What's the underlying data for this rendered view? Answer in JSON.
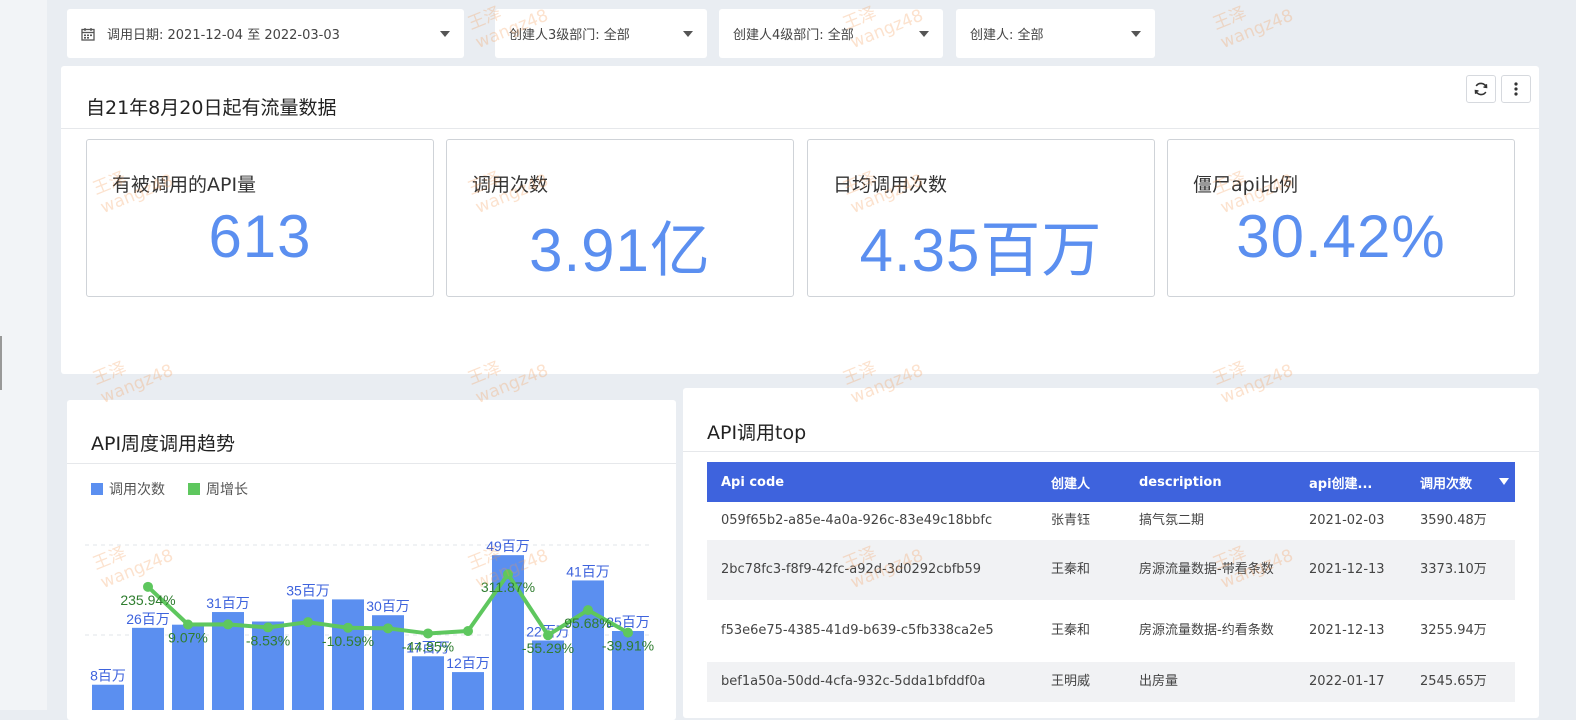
{
  "filters": {
    "date": "调用日期: 2021-12-04 至 2022-03-03",
    "dept3": "创建人3级部门: 全部",
    "dept4": "创建人4级部门: 全部",
    "creator": "创建人: 全部"
  },
  "overview": {
    "title": "自21年8月20日起有流量数据",
    "kpis": [
      {
        "label": "有被调用的API量",
        "value": "613"
      },
      {
        "label": "调用次数",
        "value": "3.91亿"
      },
      {
        "label": "日均调用次数",
        "value": "4.35百万"
      },
      {
        "label": "僵尸api比例",
        "value": "30.42%"
      }
    ]
  },
  "weekly": {
    "title": "API周度调用趋势",
    "legend": [
      "调用次数",
      "周增长"
    ]
  },
  "top": {
    "title": "API调用top",
    "headers": [
      "Api code",
      "创建人",
      "description",
      "api创建...",
      "调用次数"
    ],
    "rows": [
      [
        "059f65b2-a85e-4a0a-926c-83e49c18bbfc",
        "张青钰",
        "搞气氛二期",
        "2021-02-03",
        "3590.48万"
      ],
      [
        "2bc78fc3-f8f9-42fc-a92d-3d0292cbfb59",
        "王秦和",
        "房源流量数据-带看条数",
        "2021-12-13",
        "3373.10万"
      ],
      [
        "f53e6e75-4385-41d9-b639-c5fb338ca2e5",
        "王秦和",
        "房源流量数据-约看条数",
        "2021-12-13",
        "3255.94万"
      ],
      [
        "bef1a50a-50dd-4cfa-932c-5dda1bfddf0a",
        "王明威",
        "出房量",
        "2022-01-17",
        "2545.65万"
      ]
    ]
  },
  "watermark": {
    "name": "王泽",
    "id": "wangz48"
  },
  "colors": {
    "accent": "#5b8ff0",
    "bar": "#5b8ff0",
    "line": "#5ec75e",
    "table_header": "#3e63dd"
  },
  "chart_data": {
    "type": "bar",
    "title": "API周度调用趋势",
    "series": [
      {
        "name": "调用次数",
        "type": "bar",
        "values": [
          8,
          26,
          27,
          31,
          28,
          35,
          35,
          30,
          17,
          12,
          49,
          22,
          41,
          25
        ]
      },
      {
        "name": "周增长",
        "type": "line",
        "values": [
          null,
          235.94,
          9.07,
          9.5,
          -8.53,
          23.0,
          -10.59,
          -14.0,
          -44.85,
          -30.0,
          311.87,
          -55.29,
          95.68,
          -39.91
        ]
      }
    ],
    "bar_labels": [
      "8百万",
      "26百万",
      "",
      "31百万",
      "",
      "35百万",
      "",
      "30百万",
      "17百万",
      "12百万",
      "49百万",
      "22百万",
      "41百万",
      "25百万"
    ],
    "line_labels": [
      "",
      "235.94%",
      "9.07%",
      "",
      "-8.53%",
      "",
      "-10.59%",
      "",
      "-44.85%",
      "",
      "311.87%",
      "-55.29%",
      "95.68%",
      "-39.91%"
    ],
    "ylim": [
      0,
      50
    ],
    "grid": true,
    "legend": "top-left"
  }
}
